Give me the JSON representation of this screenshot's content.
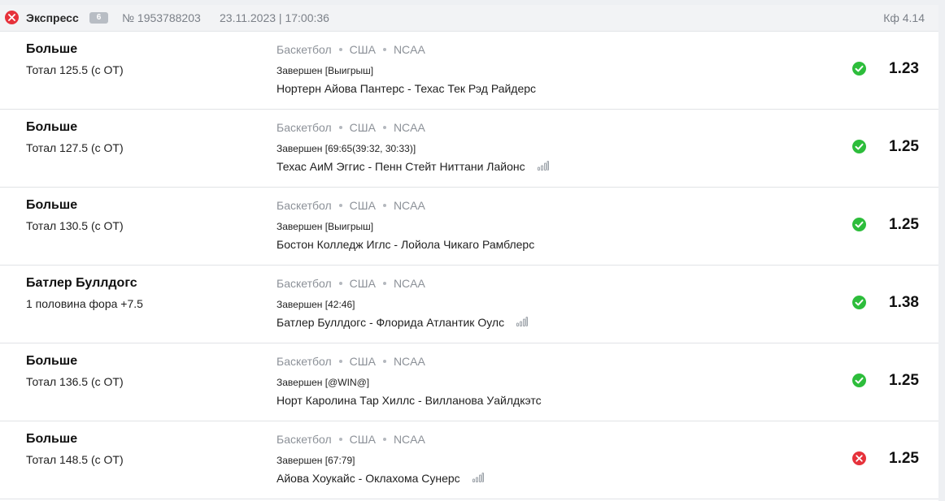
{
  "header": {
    "type_label": "Экспресс",
    "badge_count": "6",
    "bet_number": "№ 1953788203",
    "datetime": "23.11.2023 | 17:00:36",
    "coefficient": "Кф 4.14",
    "status_icon": "close-circle-icon",
    "status_color": "#e6323b"
  },
  "bets": [
    {
      "name": "Больше",
      "description": "Тотал 125.5 (с ОТ)",
      "sport": "Баскетбол",
      "country": "США",
      "league": "NCAA",
      "status": "Завершен [Выигрыш]",
      "match": "Нортерн Айова Пантерс - Техас Тек Рэд Райдерс",
      "has_stats": false,
      "result": "win",
      "odds": "1.23"
    },
    {
      "name": "Больше",
      "description": "Тотал 127.5 (с ОТ)",
      "sport": "Баскетбол",
      "country": "США",
      "league": "NCAA",
      "status": "Завершен [69:65(39:32, 30:33)]",
      "match": "Техас АиМ Эггис - Пенн Стейт Ниттани Лайонс",
      "has_stats": true,
      "result": "win",
      "odds": "1.25"
    },
    {
      "name": "Больше",
      "description": "Тотал 130.5 (с ОТ)",
      "sport": "Баскетбол",
      "country": "США",
      "league": "NCAA",
      "status": "Завершен [Выигрыш]",
      "match": "Бостон Колледж Иглс - Лойола Чикаго Рамблерс",
      "has_stats": false,
      "result": "win",
      "odds": "1.25"
    },
    {
      "name": "Батлер Буллдогс",
      "description": "1 половина фора +7.5",
      "sport": "Баскетбол",
      "country": "США",
      "league": "NCAA",
      "status": "Завершен [42:46]",
      "match": "Батлер Буллдогс - Флорида Атлантик Оулс",
      "has_stats": true,
      "result": "win",
      "odds": "1.38"
    },
    {
      "name": "Больше",
      "description": "Тотал 136.5 (с ОТ)",
      "sport": "Баскетбол",
      "country": "США",
      "league": "NCAA",
      "status": "Завершен [@WIN@]",
      "match": "Норт Каролина Тар Хиллс - Вилланова Уайлдкэтс",
      "has_stats": false,
      "result": "win",
      "odds": "1.25"
    },
    {
      "name": "Больше",
      "description": "Тотал 148.5 (с ОТ)",
      "sport": "Баскетбол",
      "country": "США",
      "league": "NCAA",
      "status": "Завершен [67:79]",
      "match": "Айова Хоукайс - Оклахома Сунерс",
      "has_stats": true,
      "result": "loss",
      "odds": "1.25"
    }
  ],
  "colors": {
    "win": "#2dbd3b",
    "loss": "#e6323b"
  }
}
